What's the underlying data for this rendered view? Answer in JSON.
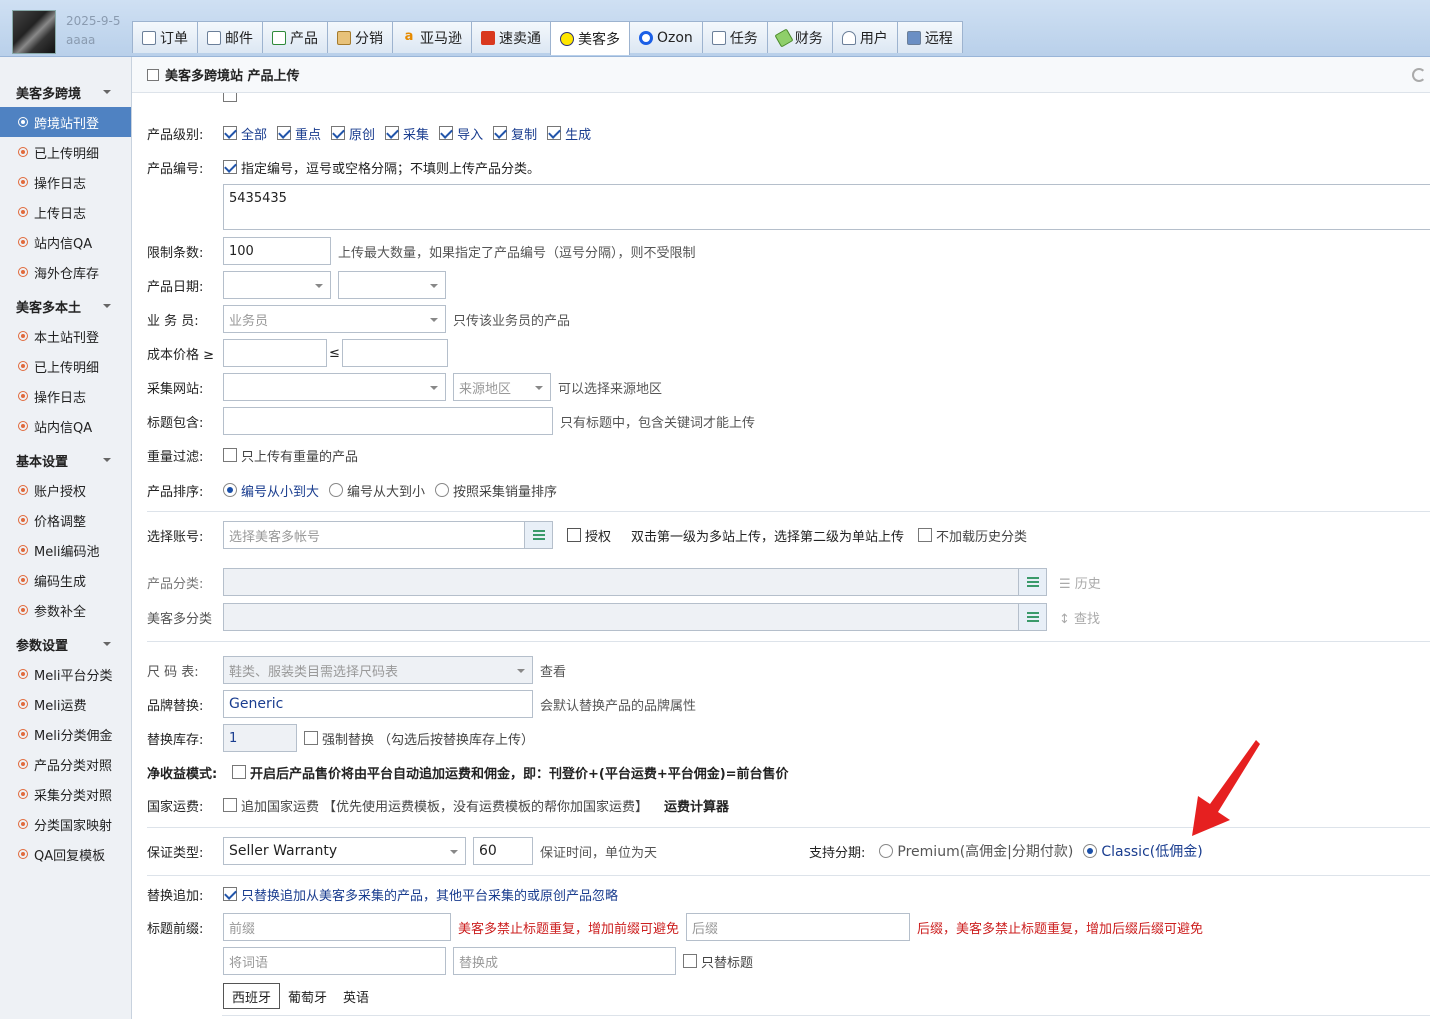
{
  "header": {
    "date": "2025-9-5",
    "user": "aaaa",
    "tabs": [
      {
        "label": "订单",
        "icon": "clipboard-icon"
      },
      {
        "label": "邮件",
        "icon": "mail-icon"
      },
      {
        "label": "产品",
        "icon": "grid-icon"
      },
      {
        "label": "分销",
        "icon": "box-icon"
      },
      {
        "label": "亚马逊",
        "icon": "amazon-icon"
      },
      {
        "label": "速卖通",
        "icon": "aliexpress-icon"
      },
      {
        "label": "美客多",
        "icon": "mercado-icon"
      },
      {
        "label": "Ozon",
        "icon": "ozon-icon"
      },
      {
        "label": "任务",
        "icon": "task-icon"
      },
      {
        "label": "财务",
        "icon": "money-icon"
      },
      {
        "label": "用户",
        "icon": "user-icon"
      },
      {
        "label": "远程",
        "icon": "monitor-icon"
      }
    ],
    "active_tab": "美客多"
  },
  "sidebar": {
    "groups": [
      {
        "title": "美客多跨境",
        "items": [
          "跨境站刊登",
          "已上传明细",
          "操作日志",
          "上传日志",
          "站内信QA",
          "海外仓库存"
        ]
      },
      {
        "title": "美客多本土",
        "items": [
          "本土站刊登",
          "已上传明细",
          "操作日志",
          "站内信QA"
        ]
      },
      {
        "title": "基本设置",
        "items": [
          "账户授权",
          "价格调整",
          "Meli编码池",
          "编码生成",
          "参数补全"
        ]
      },
      {
        "title": "参数设置",
        "items": [
          "Meli平台分类",
          "Meli运费",
          "Meli分类佣金",
          "产品分类对照",
          "采集分类对照",
          "分类国家映射",
          "QA回复模板"
        ]
      }
    ],
    "active_item": "跨境站刊登"
  },
  "panel": {
    "title": "美客多跨境站 产品上传"
  },
  "form": {
    "level_label": "产品级别:",
    "level_options": [
      "全部",
      "重点",
      "原创",
      "采集",
      "导入",
      "复制",
      "生成"
    ],
    "code_label": "产品编号:",
    "code_check": "指定编号，逗号或空格分隔；不填则上传产品分类。",
    "code_value": "5435435",
    "limit_label": "限制条数:",
    "limit_value": "100",
    "limit_hint": "上传最大数量，如果指定了产品编号（逗号分隔），则不受限制",
    "date_label": "产品日期:",
    "staff_label": "业 务 员:",
    "staff_placeholder": "业务员",
    "staff_hint": "只传该业务员的产品",
    "cost_label": "成本价格 ≥",
    "cost_le": "≤",
    "site_label": "采集网站:",
    "region_placeholder": "来源地区",
    "region_hint": "可以选择来源地区",
    "title_label": "标题包含:",
    "title_hint": "只有标题中，包含关键词才能上传",
    "weight_label": "重量过滤:",
    "weight_check": "只上传有重量的产品",
    "sort_label": "产品排序:",
    "sort_options": [
      "编号从小到大",
      "编号从大到小",
      "按照采集销量排序"
    ],
    "account_label": "选择账号:",
    "account_placeholder": "选择美客多帐号",
    "auth_label": "授权",
    "account_hint": "双击第一级为多站上传，选择第二级为单站上传",
    "no_history": "不加载历史分类",
    "category_label": "产品分类:",
    "history_label": "历史",
    "meli_category_label": "美客多分类",
    "find_label": "查找",
    "size_label": "尺 码 表:",
    "size_placeholder": "鞋类、服装类目需选择尺码表",
    "size_view": "查看",
    "brand_label": "品牌替换:",
    "brand_value": "Generic",
    "brand_hint": "会默认替换产品的品牌属性",
    "stock_label": "替换库存:",
    "stock_value": "1",
    "stock_force": "强制替换",
    "stock_hint": "（勾选后按替换库存上传）",
    "net_label": "净收益模式:",
    "net_text": "开启后产品售价将由平台自动追加运费和佣金，即：刊登价+(平台运费+平台佣金)=前台售价",
    "ship_label": "国家运费:",
    "ship_check": "追加国家运费",
    "ship_hint": "【优先使用运费模板，没有运费模板的帮你加国家运费】",
    "ship_calc": "运费计算器",
    "warranty_label": "保证类型:",
    "warranty_value": "Seller Warranty",
    "warranty_time": "60",
    "warranty_hint": "保证时间，单位为天",
    "install_label": "支持分期:",
    "install_premium": "Premium(高佣金|分期付款)",
    "install_classic": "Classic(低佣金)",
    "replace_label": "替换追加:",
    "replace_check": "只替换追加从美客多采集的产品，其他平台采集的或原创产品忽略",
    "prefix_label": "标题前缀:",
    "prefix_placeholder": "前缀",
    "prefix_hint": "美客多禁止标题重复，增加前缀可避免",
    "suffix_placeholder": "后缀",
    "suffix_hint": "后缀，美客多禁止标题重复，增加后缀后缀可避免",
    "word_placeholder": "将词语",
    "replace_placeholder": "替换成",
    "only_title": "只替标题",
    "lang_tabs": [
      "西班牙",
      "葡萄牙",
      "英语"
    ]
  },
  "colors": {
    "accent": "#4f82c2",
    "warning": "#cc1f1f",
    "arrow": "#e62020"
  }
}
